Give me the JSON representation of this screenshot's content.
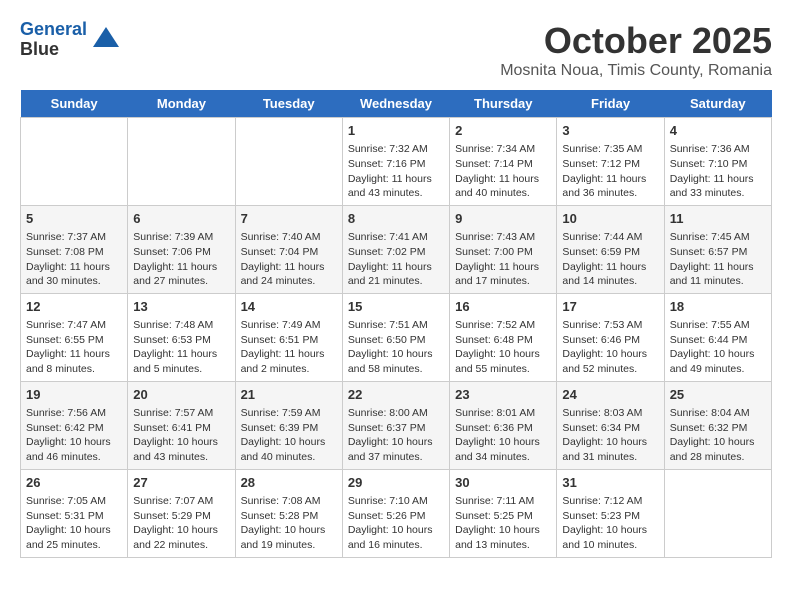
{
  "header": {
    "logo_line1": "General",
    "logo_line2": "Blue",
    "month_title": "October 2025",
    "subtitle": "Mosnita Noua, Timis County, Romania"
  },
  "weekdays": [
    "Sunday",
    "Monday",
    "Tuesday",
    "Wednesday",
    "Thursday",
    "Friday",
    "Saturday"
  ],
  "weeks": [
    [
      {
        "day": "",
        "info": ""
      },
      {
        "day": "",
        "info": ""
      },
      {
        "day": "",
        "info": ""
      },
      {
        "day": "1",
        "info": "Sunrise: 7:32 AM\nSunset: 7:16 PM\nDaylight: 11 hours\nand 43 minutes."
      },
      {
        "day": "2",
        "info": "Sunrise: 7:34 AM\nSunset: 7:14 PM\nDaylight: 11 hours\nand 40 minutes."
      },
      {
        "day": "3",
        "info": "Sunrise: 7:35 AM\nSunset: 7:12 PM\nDaylight: 11 hours\nand 36 minutes."
      },
      {
        "day": "4",
        "info": "Sunrise: 7:36 AM\nSunset: 7:10 PM\nDaylight: 11 hours\nand 33 minutes."
      }
    ],
    [
      {
        "day": "5",
        "info": "Sunrise: 7:37 AM\nSunset: 7:08 PM\nDaylight: 11 hours\nand 30 minutes."
      },
      {
        "day": "6",
        "info": "Sunrise: 7:39 AM\nSunset: 7:06 PM\nDaylight: 11 hours\nand 27 minutes."
      },
      {
        "day": "7",
        "info": "Sunrise: 7:40 AM\nSunset: 7:04 PM\nDaylight: 11 hours\nand 24 minutes."
      },
      {
        "day": "8",
        "info": "Sunrise: 7:41 AM\nSunset: 7:02 PM\nDaylight: 11 hours\nand 21 minutes."
      },
      {
        "day": "9",
        "info": "Sunrise: 7:43 AM\nSunset: 7:00 PM\nDaylight: 11 hours\nand 17 minutes."
      },
      {
        "day": "10",
        "info": "Sunrise: 7:44 AM\nSunset: 6:59 PM\nDaylight: 11 hours\nand 14 minutes."
      },
      {
        "day": "11",
        "info": "Sunrise: 7:45 AM\nSunset: 6:57 PM\nDaylight: 11 hours\nand 11 minutes."
      }
    ],
    [
      {
        "day": "12",
        "info": "Sunrise: 7:47 AM\nSunset: 6:55 PM\nDaylight: 11 hours\nand 8 minutes."
      },
      {
        "day": "13",
        "info": "Sunrise: 7:48 AM\nSunset: 6:53 PM\nDaylight: 11 hours\nand 5 minutes."
      },
      {
        "day": "14",
        "info": "Sunrise: 7:49 AM\nSunset: 6:51 PM\nDaylight: 11 hours\nand 2 minutes."
      },
      {
        "day": "15",
        "info": "Sunrise: 7:51 AM\nSunset: 6:50 PM\nDaylight: 10 hours\nand 58 minutes."
      },
      {
        "day": "16",
        "info": "Sunrise: 7:52 AM\nSunset: 6:48 PM\nDaylight: 10 hours\nand 55 minutes."
      },
      {
        "day": "17",
        "info": "Sunrise: 7:53 AM\nSunset: 6:46 PM\nDaylight: 10 hours\nand 52 minutes."
      },
      {
        "day": "18",
        "info": "Sunrise: 7:55 AM\nSunset: 6:44 PM\nDaylight: 10 hours\nand 49 minutes."
      }
    ],
    [
      {
        "day": "19",
        "info": "Sunrise: 7:56 AM\nSunset: 6:42 PM\nDaylight: 10 hours\nand 46 minutes."
      },
      {
        "day": "20",
        "info": "Sunrise: 7:57 AM\nSunset: 6:41 PM\nDaylight: 10 hours\nand 43 minutes."
      },
      {
        "day": "21",
        "info": "Sunrise: 7:59 AM\nSunset: 6:39 PM\nDaylight: 10 hours\nand 40 minutes."
      },
      {
        "day": "22",
        "info": "Sunrise: 8:00 AM\nSunset: 6:37 PM\nDaylight: 10 hours\nand 37 minutes."
      },
      {
        "day": "23",
        "info": "Sunrise: 8:01 AM\nSunset: 6:36 PM\nDaylight: 10 hours\nand 34 minutes."
      },
      {
        "day": "24",
        "info": "Sunrise: 8:03 AM\nSunset: 6:34 PM\nDaylight: 10 hours\nand 31 minutes."
      },
      {
        "day": "25",
        "info": "Sunrise: 8:04 AM\nSunset: 6:32 PM\nDaylight: 10 hours\nand 28 minutes."
      }
    ],
    [
      {
        "day": "26",
        "info": "Sunrise: 7:05 AM\nSunset: 5:31 PM\nDaylight: 10 hours\nand 25 minutes."
      },
      {
        "day": "27",
        "info": "Sunrise: 7:07 AM\nSunset: 5:29 PM\nDaylight: 10 hours\nand 22 minutes."
      },
      {
        "day": "28",
        "info": "Sunrise: 7:08 AM\nSunset: 5:28 PM\nDaylight: 10 hours\nand 19 minutes."
      },
      {
        "day": "29",
        "info": "Sunrise: 7:10 AM\nSunset: 5:26 PM\nDaylight: 10 hours\nand 16 minutes."
      },
      {
        "day": "30",
        "info": "Sunrise: 7:11 AM\nSunset: 5:25 PM\nDaylight: 10 hours\nand 13 minutes."
      },
      {
        "day": "31",
        "info": "Sunrise: 7:12 AM\nSunset: 5:23 PM\nDaylight: 10 hours\nand 10 minutes."
      },
      {
        "day": "",
        "info": ""
      }
    ]
  ]
}
